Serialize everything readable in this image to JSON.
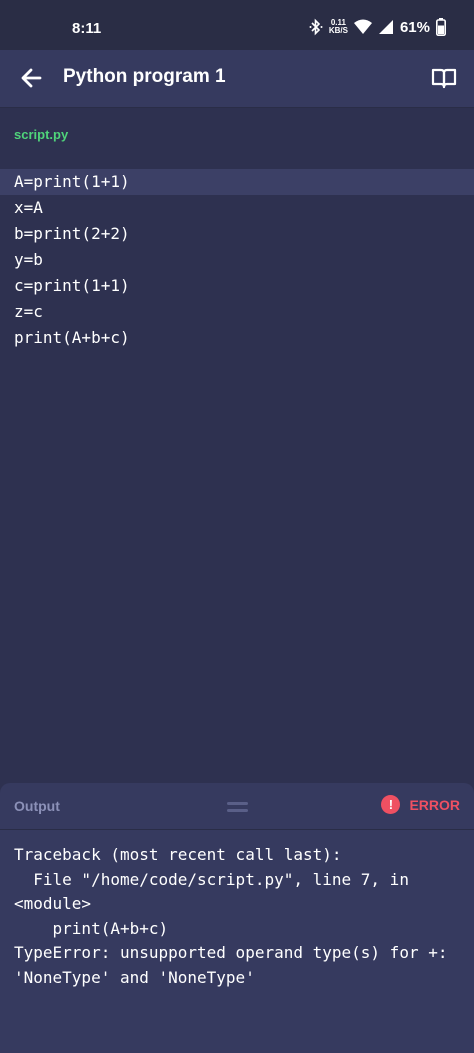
{
  "status_bar": {
    "time": "8:11",
    "net_speed_value": "0.11",
    "net_speed_unit": "KB/S",
    "battery": "61%"
  },
  "app_bar": {
    "title": "Python program 1",
    "back_icon": "arrow-left-icon",
    "book_icon": "book-open-icon"
  },
  "file_tab": {
    "name": "script.py"
  },
  "editor": {
    "lines": [
      "A=print(1+1)",
      "x=A",
      "b=print(2+2)",
      "y=b",
      "c=print(1+1)",
      "z=c",
      "print(A+b+c)"
    ]
  },
  "output": {
    "label": "Output",
    "status": "ERROR",
    "text": "Traceback (most recent call last):\n  File \"/home/code/script.py\", line 7, in\n<module>\n    print(A+b+c)\nTypeError: unsupported operand type(s) for +:\n'NoneType' and 'NoneType'"
  },
  "colors": {
    "background": "#2e3150",
    "header": "#363a5f",
    "accent_green": "#4fd37a",
    "error_red": "#ef5062"
  }
}
